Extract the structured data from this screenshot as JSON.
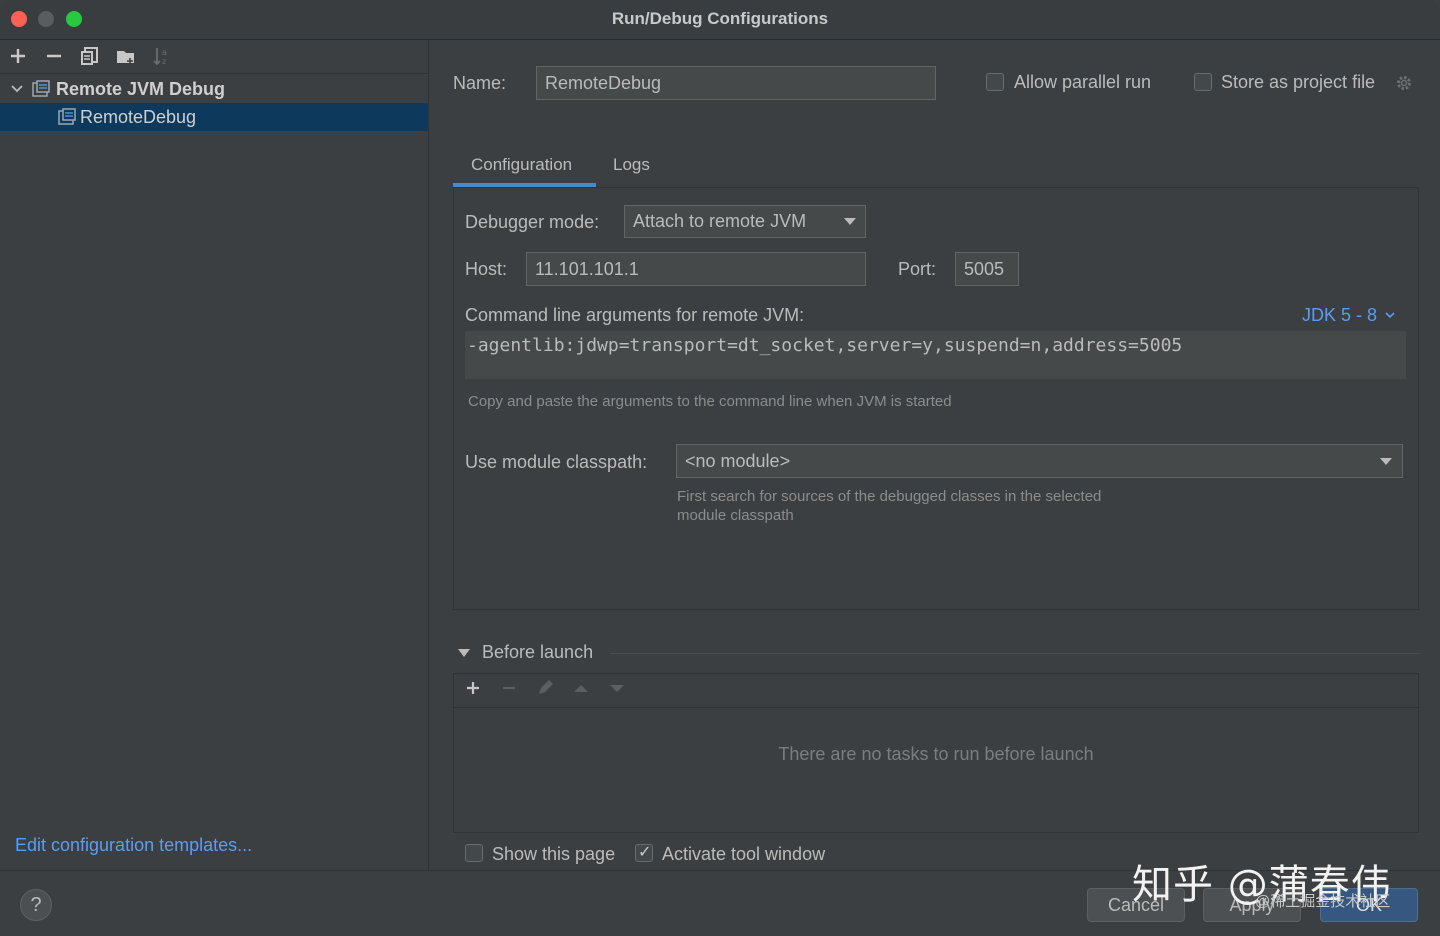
{
  "window": {
    "title": "Run/Debug Configurations"
  },
  "toolbar": {
    "icons": [
      "add-icon",
      "remove-icon",
      "copy-icon",
      "folder-icon",
      "sort-icon"
    ]
  },
  "tree": {
    "group_label": "Remote JVM Debug",
    "item_label": "RemoteDebug"
  },
  "left_footer": {
    "edit_templates": "Edit configuration templates..."
  },
  "form": {
    "name_label": "Name:",
    "name_value": "RemoteDebug",
    "allow_parallel_label": "Allow parallel run",
    "allow_parallel_checked": false,
    "store_project_label": "Store as project file",
    "store_project_checked": false
  },
  "tabs": [
    {
      "label": "Configuration",
      "active": true
    },
    {
      "label": "Logs",
      "active": false
    }
  ],
  "config": {
    "debugger_mode_label": "Debugger mode:",
    "debugger_mode_value": "Attach to remote JVM",
    "host_label": "Host:",
    "host_value": "11.101.101.1",
    "port_label": "Port:",
    "port_value": "5005",
    "cmd_label": "Command line arguments for remote JVM:",
    "jdk_link": "JDK 5 - 8",
    "cmd_value": "-agentlib:jdwp=transport=dt_socket,server=y,suspend=n,address=5005",
    "cmd_hint": "Copy and paste the arguments to the command line when JVM is started",
    "module_label": "Use module classpath:",
    "module_value": "<no module>",
    "module_hint_1": "First search for sources of the debugged classes in the selected",
    "module_hint_2": "module classpath"
  },
  "before_launch": {
    "title": "Before launch",
    "empty_text": "There are no tasks to run before launch",
    "show_page_label": "Show this page",
    "show_page_checked": false,
    "activate_tool_label": "Activate tool window",
    "activate_tool_checked": true
  },
  "buttons": {
    "help": "?",
    "cancel": "Cancel",
    "apply": "Apply",
    "ok": "OK"
  },
  "watermark": {
    "main": "知乎 @蒲春伟",
    "sub": "@稀土掘金技术社区"
  },
  "colors": {
    "background": "#3c3f41",
    "selection": "#0d3a5c",
    "accent_link": "#589df6",
    "tab_underline": "#4a88c7",
    "primary_button": "#365880"
  }
}
